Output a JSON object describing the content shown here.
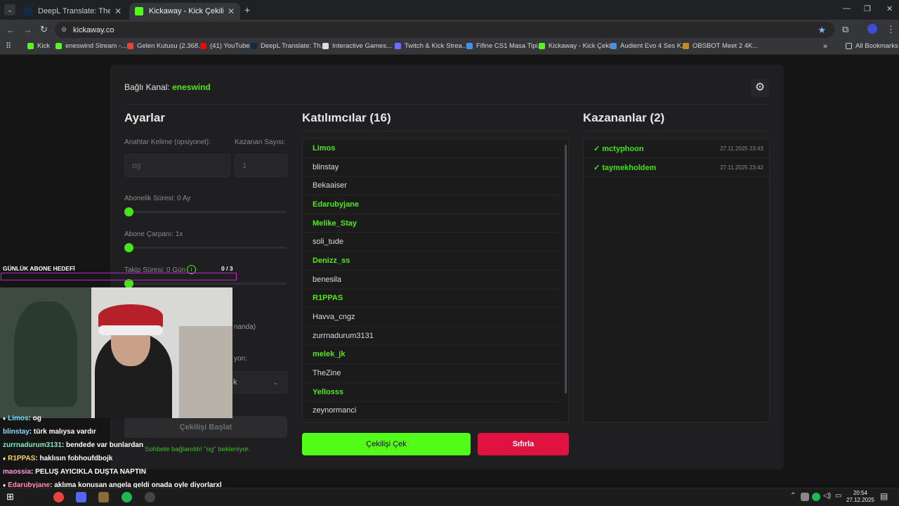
{
  "browser": {
    "tabs": [
      {
        "title": "DeepL Translate: The world's m",
        "active": false
      },
      {
        "title": "Kickaway - Kick Çekiliş Aracı",
        "active": true
      }
    ],
    "url": "kickaway.co",
    "bookmarks": [
      "Kick",
      "eneswind Stream -...",
      "Gelen Kutusu (2.368...",
      "(41) YouTube",
      "DeepL Translate: Th...",
      "Interactive Games...",
      "Twitch & Kick Strea...",
      "Fifine CS1 Masa Tipi...",
      "Kickaway - Kick Çeki...",
      "Audient Evo 4 Ses K...",
      "OBSBOT Meet 2 4K..."
    ],
    "all_bookmarks": "All Bookmarks"
  },
  "app": {
    "channel_label": "Bağlı Kanal:",
    "channel_name": "eneswind",
    "settings": {
      "title": "Ayarlar",
      "keyword_label": "Anahtar Kelime (opsiyonel):",
      "keyword_value": "og",
      "winner_count_label": "Kazanan Sayısı:",
      "winner_count_value": "1",
      "sub_duration_label": "Abonelik Süresi: 0 Ay",
      "sub_multiplier_label": "Abone Çarpanı: 1x",
      "follow_duration_label": "Takip Süresi: 0 Gün",
      "partial_label_1": "nanda)",
      "partial_label_2": "yon:",
      "partial_select": "k",
      "start_button": "Çekilişi Başlat",
      "status": "Sohbete bağlanıldı! \"og\" bekleniyor."
    },
    "participants": {
      "title": "Katılımcılar (16)",
      "items": [
        {
          "name": "Limos",
          "sub": true
        },
        {
          "name": "blinstay",
          "sub": false
        },
        {
          "name": "Bekaaiser",
          "sub": false
        },
        {
          "name": "Edarubyjane",
          "sub": true
        },
        {
          "name": "Melike_Stay",
          "sub": true
        },
        {
          "name": "soli_tude",
          "sub": false
        },
        {
          "name": "Denizz_ss",
          "sub": true
        },
        {
          "name": "benesila",
          "sub": false
        },
        {
          "name": "R1PPAS",
          "sub": true
        },
        {
          "name": "Havva_cngz",
          "sub": false
        },
        {
          "name": "zurrnadurum3131",
          "sub": false
        },
        {
          "name": "melek_jk",
          "sub": true
        },
        {
          "name": "TheZine",
          "sub": false
        },
        {
          "name": "Yellosss",
          "sub": true
        },
        {
          "name": "zeynormanci",
          "sub": false
        }
      ]
    },
    "winners": {
      "title": "Kazananlar (2)",
      "items": [
        {
          "name": "✓ mctyphoon",
          "time": "27.11.2025 23:43"
        },
        {
          "name": "✓ taymekholdem",
          "time": "27.11.2025 23:42"
        }
      ]
    },
    "draw_button": "Çekilişi Çek",
    "reset_button": "Sıfırla",
    "colors": {
      "accent": "#53e61f",
      "danger": "#e0123f"
    }
  },
  "overlay": {
    "goal_title": "GÜNLÜK ABONE HEDEFİ",
    "goal_count": "0",
    "goal_total": "/ 3",
    "chat": [
      {
        "user": "Limos",
        "msg": " : og",
        "color": "#6fe3ff"
      },
      {
        "user": "blinstay",
        "msg": " : türk malıysa vardır",
        "color": "#8fd8ff"
      },
      {
        "user": "zurrnadurum3131",
        "msg": " : bendede var bunlardan",
        "color": "#7df0c0"
      },
      {
        "user": "R1PPAS",
        "msg": " : haklısın fobhoufdbojk",
        "color": "#ffd25a"
      },
      {
        "user": "maossia",
        "msg": " : PELUŞ AYICIKLA DUŞTA NAPTIN",
        "color": "#ff9ad6"
      },
      {
        "user": "Edarubyjane",
        "msg": " : aklıma konusan angela geldi onada oyle diyorlarxl",
        "color": "#ff8fb3"
      }
    ]
  },
  "taskbar": {
    "time": "20:54",
    "date": "27.12.2025"
  }
}
